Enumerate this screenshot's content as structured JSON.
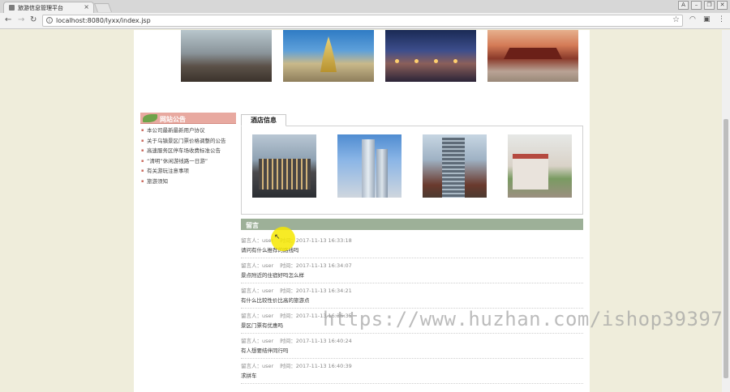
{
  "browser": {
    "tab_title": "旅游信息管理平台",
    "tab_close": "×",
    "url": "localhost:8080/lyxx/index.jsp",
    "window_buttons": [
      "A",
      "–",
      "❐",
      "✕"
    ]
  },
  "gallery": {
    "photos": [
      "mountain-scenery",
      "golden-pagoda",
      "night-lights",
      "palace-gate"
    ]
  },
  "notice": {
    "title": "网站公告",
    "items": [
      "本公司最新最新用户协议",
      "关于乌镇景区门票价格调整的公告",
      "高速服务区停车场收费标准公告",
      "“清明”休闲游线路一日游”",
      "有关游玩注意事项",
      "旅游须知"
    ]
  },
  "hotel": {
    "tab_label": "酒店信息",
    "photos": [
      "hotel-1",
      "hotel-2",
      "hotel-3",
      "hotel-4"
    ]
  },
  "messages": {
    "title": "留言",
    "author_label": "留言人：",
    "time_label": "时间：",
    "items": [
      {
        "author": "user",
        "time": "2017-11-13 16:33:18",
        "text": "请问有什么推荐的路线吗"
      },
      {
        "author": "user",
        "time": "2017-11-13 16:34:07",
        "text": "景点附近的住宿好吗怎么样"
      },
      {
        "author": "user",
        "time": "2017-11-13 16:34:21",
        "text": "有什么比较性价比高的旅游点"
      },
      {
        "author": "user",
        "time": "2017-11-13 16:36:35",
        "text": "景区门票有优惠吗"
      },
      {
        "author": "user",
        "time": "2017-11-13 16:40:24",
        "text": "有人想要结伴同行吗"
      },
      {
        "author": "user",
        "time": "2017-11-13 16:40:39",
        "text": "求拼车"
      }
    ]
  },
  "watermark": "https://www.huzhan.com/ishop39397",
  "colors": {
    "notice_header": "#e8a9a0",
    "message_header": "#9db098",
    "page_background": "#efeddb"
  }
}
